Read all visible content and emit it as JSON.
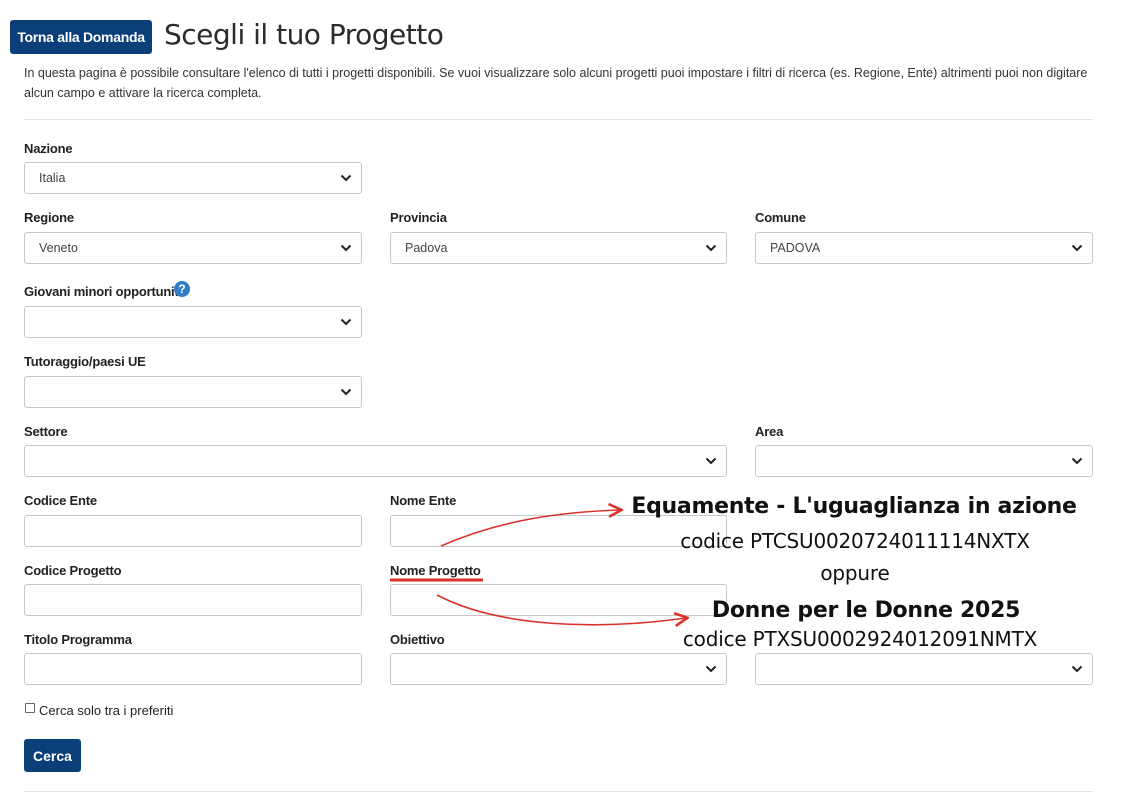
{
  "header": {
    "back_label": "Torna alla Domanda",
    "title": "Scegli il tuo Progetto"
  },
  "intro": "In questa pagina è possibile consultare l'elenco di tutti i progetti disponibili. Se vuoi visualizzare solo alcuni progetti puoi impostare i filtri di ricerca (es. Regione, Ente) altrimenti puoi non digitare alcun campo e attivare la ricerca completa.",
  "form": {
    "nazione": {
      "label": "Nazione",
      "value": "Italia"
    },
    "regione": {
      "label": "Regione",
      "value": "Veneto"
    },
    "provincia": {
      "label": "Provincia",
      "value": "Padova"
    },
    "comune": {
      "label": "Comune",
      "value": "PADOVA"
    },
    "giovani": {
      "label": "Giovani minori opportunità",
      "value": ""
    },
    "tutoraggio": {
      "label": "Tutoraggio/paesi UE",
      "value": ""
    },
    "settore": {
      "label": "Settore",
      "value": ""
    },
    "area": {
      "label": "Area",
      "value": ""
    },
    "codice_ente": {
      "label": "Codice Ente",
      "value": ""
    },
    "nome_ente": {
      "label": "Nome Ente",
      "value": ""
    },
    "codice_progetto": {
      "label": "Codice Progetto",
      "value": ""
    },
    "nome_progetto": {
      "label": "Nome Progetto",
      "value": ""
    },
    "titolo_programma": {
      "label": "Titolo Programma",
      "value": ""
    },
    "obiettivo": {
      "label": "Obiettivo",
      "value": ""
    },
    "extra_select": {
      "value": ""
    },
    "preferiti_label": "Cerca solo tra i preferiti",
    "preferiti_checked": false,
    "search_label": "Cerca"
  },
  "annotation": {
    "project1_name": "Equamente - L'uguaglianza in azione",
    "project1_code": "codice PTCSU0020724011114NXTX",
    "or": "oppure",
    "project2_name": "Donne per le Donne 2025",
    "project2_code": "codice PTXSU0002924012091NMTX",
    "arrow_color": "#d9322b"
  },
  "icons": {
    "help": "question-mark-icon",
    "select": "chevron-down-icon"
  },
  "colors": {
    "primary": "#0b3f7a",
    "help_icon": "#2f7dc4",
    "annotation": "#d9322b"
  }
}
